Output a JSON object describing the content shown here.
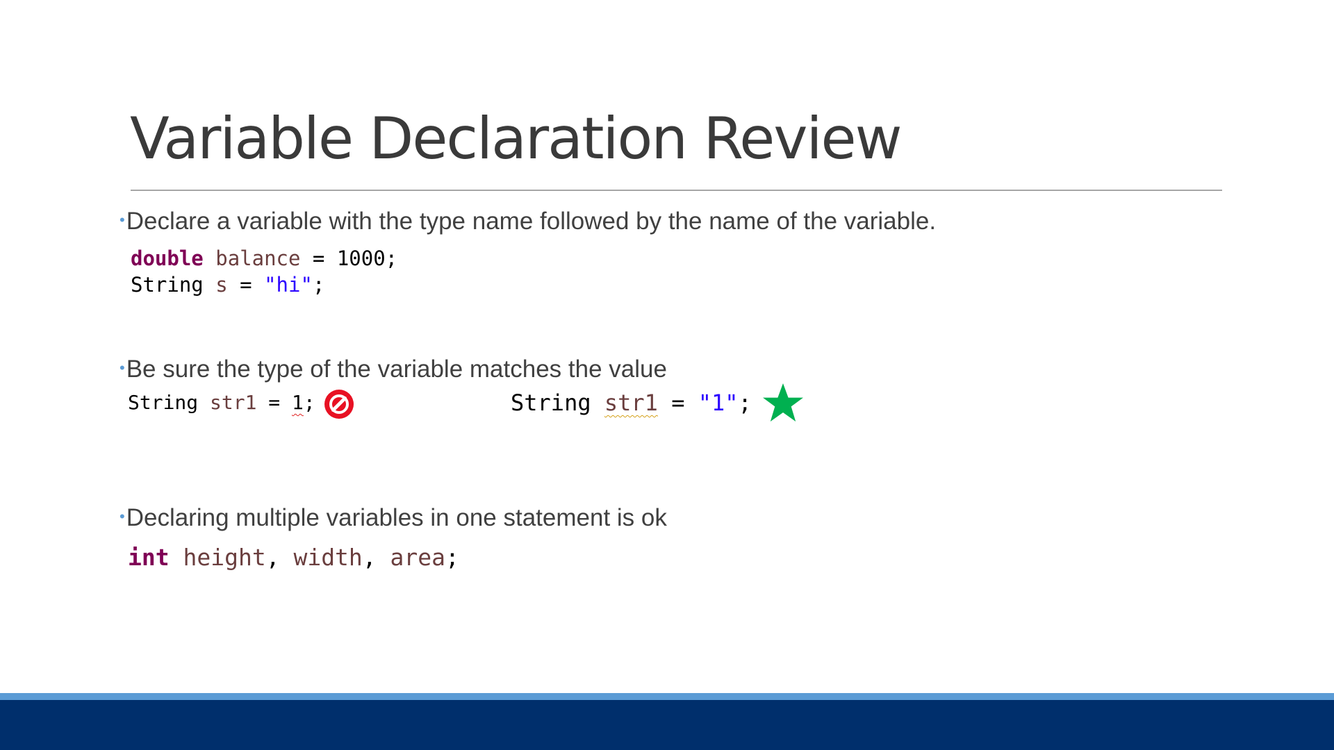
{
  "slide": {
    "title": "Variable Declaration Review",
    "bullet_marker": "•",
    "bullets": [
      "Declare a variable with the type name followed by the name of the variable.",
      "Be sure the type of the variable matches the value",
      "Declaring multiple variables in one statement is ok"
    ]
  },
  "code": {
    "line1": {
      "kw": "double",
      "id": "balance",
      "rest": " = 1000;"
    },
    "line2": {
      "type": "String",
      "id": "s",
      "eq": " = ",
      "str": "\"hi\"",
      "end": ";"
    },
    "wrong": {
      "type": "String",
      "id": "str1",
      "eq": " = ",
      "num": "1",
      "end": ";"
    },
    "right": {
      "type": "String",
      "id": "str1",
      "eq": " = ",
      "str": "\"1\"",
      "end": ";"
    },
    "multi": {
      "kw": "int",
      "a": "height",
      "sep1": ", ",
      "b": "width",
      "sep2": ", ",
      "c": "area",
      "end": ";"
    }
  },
  "icons": {
    "wrong": "no-entry-icon",
    "right": "star-icon",
    "wrong_color": "#e81123",
    "right_color": "#00b050"
  },
  "colors": {
    "accent_blue": "#5b9bd5",
    "footer_navy": "#002f6c",
    "keyword": "#7f0055",
    "identifier": "#6a3e3e",
    "string": "#2a00ff"
  }
}
